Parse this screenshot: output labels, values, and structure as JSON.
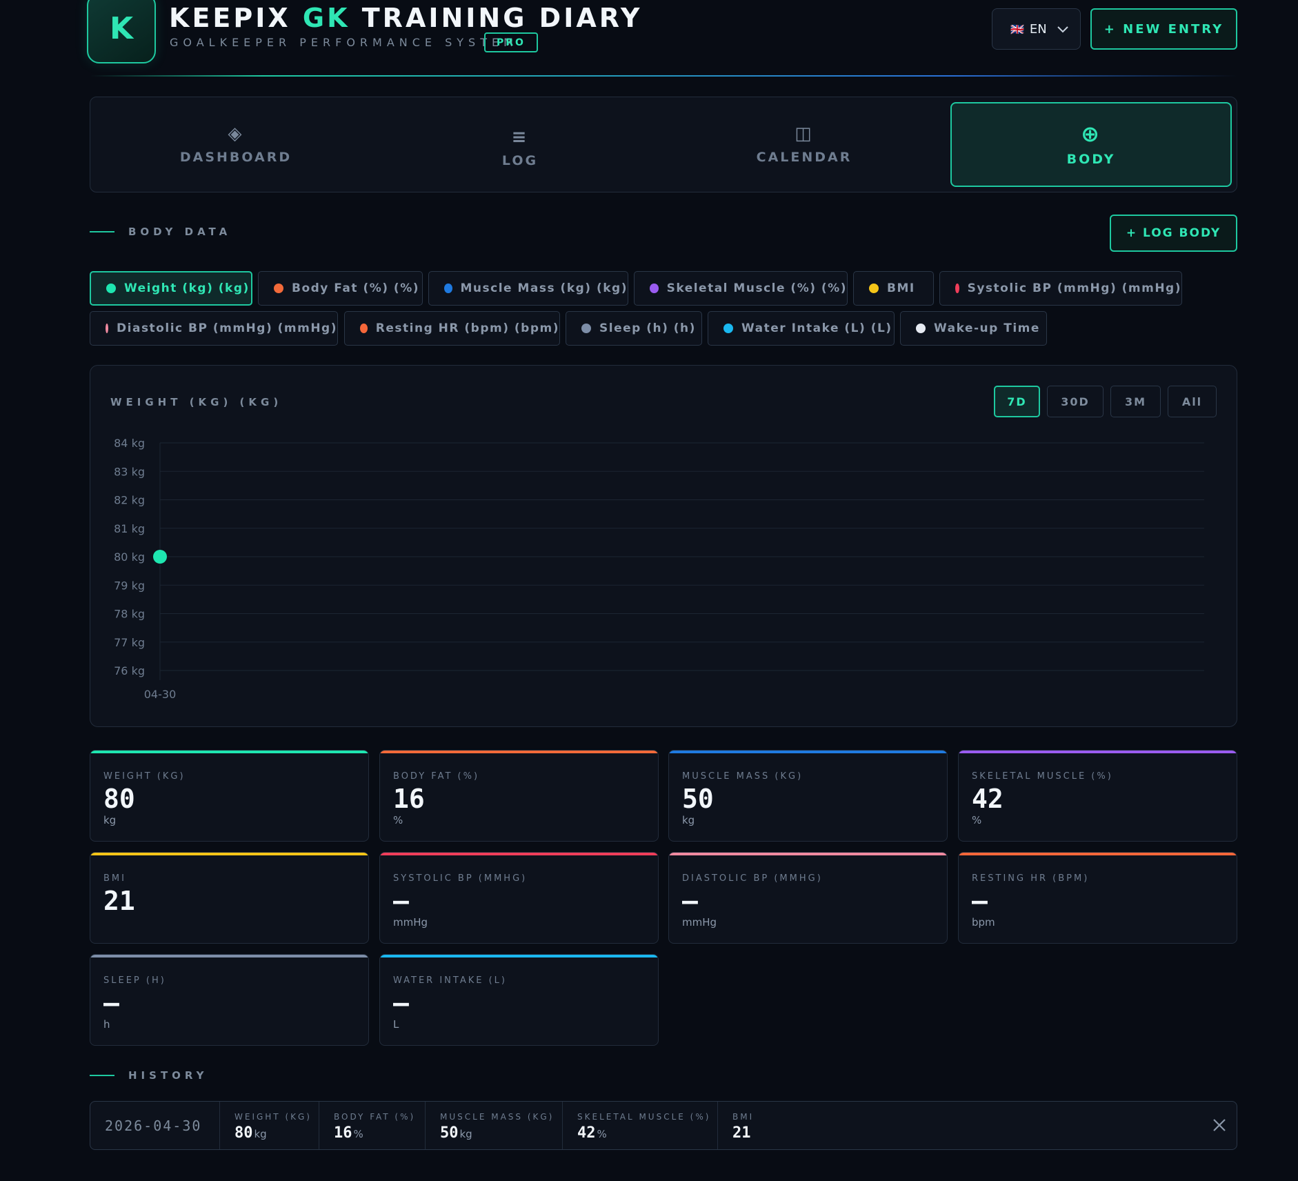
{
  "header": {
    "logo_letter": "K",
    "title_part1": "KEEPIX",
    "title_accent": "GK",
    "title_part2": "TRAINING DIARY",
    "subtitle": "GOALKEEPER PERFORMANCE SYSTEM",
    "badge": "PRO",
    "language": {
      "flag": "🇬🇧",
      "code": "EN"
    },
    "new_entry_label": "+ NEW ENTRY"
  },
  "tabs": [
    {
      "icon": "diamond-icon",
      "glyph": "◈",
      "label": "DASHBOARD",
      "active": false
    },
    {
      "icon": "list-icon",
      "glyph": "≡",
      "label": "LOG",
      "active": false
    },
    {
      "icon": "calendar-icon",
      "glyph": "◫",
      "label": "CALENDAR",
      "active": false
    },
    {
      "icon": "plus-circle-icon",
      "glyph": "⊕",
      "label": "BODY",
      "active": true
    }
  ],
  "body_section": {
    "label": "BODY DATA",
    "log_body_label": "+ LOG BODY"
  },
  "metric_chips": [
    {
      "label": "Weight (kg) (kg)",
      "color": "#1ee6b0",
      "active": true
    },
    {
      "label": "Body Fat (%) (%)",
      "color": "#f26a3a",
      "active": false
    },
    {
      "label": "Muscle Mass (kg) (kg)",
      "color": "#1f7ae0",
      "active": false
    },
    {
      "label": "Skeletal Muscle (%) (%)",
      "color": "#9a5cf0",
      "active": false
    },
    {
      "label": "BMI",
      "color": "#f5c518",
      "active": false
    },
    {
      "label": "Systolic BP (mmHg) (mmHg)",
      "color": "#f03e5a",
      "active": false
    },
    {
      "label": "Diastolic BP (mmHg) (mmHg)",
      "color": "#f08aa0",
      "active": false
    },
    {
      "label": "Resting HR (bpm) (bpm)",
      "color": "#f5673a",
      "active": false
    },
    {
      "label": "Sleep (h) (h)",
      "color": "#7d8ea8",
      "active": false
    },
    {
      "label": "Water Intake (L) (L)",
      "color": "#1ab8f0",
      "active": false
    },
    {
      "label": "Wake-up Time",
      "color": "#e6eaf2",
      "active": false
    }
  ],
  "chart": {
    "title": "WEIGHT (KG) (KG)",
    "ranges": [
      {
        "label": "7D",
        "active": true
      },
      {
        "label": "30D",
        "active": false
      },
      {
        "label": "3M",
        "active": false
      },
      {
        "label": "All",
        "active": false
      }
    ]
  },
  "chart_data": {
    "type": "scatter",
    "x": [
      "04-30"
    ],
    "series": [
      {
        "values": [
          80
        ],
        "color": "#1ee6b0"
      }
    ],
    "ylim": [
      76,
      84
    ],
    "yticks": [
      "84 kg",
      "83 kg",
      "82 kg",
      "81 kg",
      "80 kg",
      "79 kg",
      "78 kg",
      "77 kg",
      "76 kg"
    ],
    "grid": true
  },
  "stats": [
    {
      "label": "WEIGHT (KG)",
      "value": "80",
      "unit": "kg",
      "color": "#1ee6b0"
    },
    {
      "label": "BODY FAT (%)",
      "value": "16",
      "unit": "%",
      "color": "#f26a3a"
    },
    {
      "label": "MUSCLE MASS (KG)",
      "value": "50",
      "unit": "kg",
      "color": "#1f7ae0"
    },
    {
      "label": "SKELETAL MUSCLE (%)",
      "value": "42",
      "unit": "%",
      "color": "#9a5cf0"
    },
    {
      "label": "BMI",
      "value": "21",
      "unit": "",
      "color": "#f5c518"
    },
    {
      "label": "SYSTOLIC BP (MMHG)",
      "value": "—",
      "unit": "mmHg",
      "color": "#f03e5a"
    },
    {
      "label": "DIASTOLIC BP (MMHG)",
      "value": "—",
      "unit": "mmHg",
      "color": "#f08aa0"
    },
    {
      "label": "RESTING HR (BPM)",
      "value": "—",
      "unit": "bpm",
      "color": "#f5673a"
    },
    {
      "label": "SLEEP (H)",
      "value": "—",
      "unit": "h",
      "color": "#7d8ea8"
    },
    {
      "label": "WATER INTAKE (L)",
      "value": "—",
      "unit": "L",
      "color": "#1ab8f0"
    }
  ],
  "history": {
    "label": "HISTORY",
    "rows": [
      {
        "date": "2026-04-30",
        "fields": [
          {
            "label": "WEIGHT (KG)",
            "value": "80",
            "unit": "kg"
          },
          {
            "label": "BODY FAT (%)",
            "value": "16",
            "unit": "%"
          },
          {
            "label": "MUSCLE MASS (KG)",
            "value": "50",
            "unit": "kg"
          },
          {
            "label": "SKELETAL MUSCLE (%)",
            "value": "42",
            "unit": "%"
          },
          {
            "label": "BMI",
            "value": "21",
            "unit": ""
          }
        ]
      }
    ]
  }
}
